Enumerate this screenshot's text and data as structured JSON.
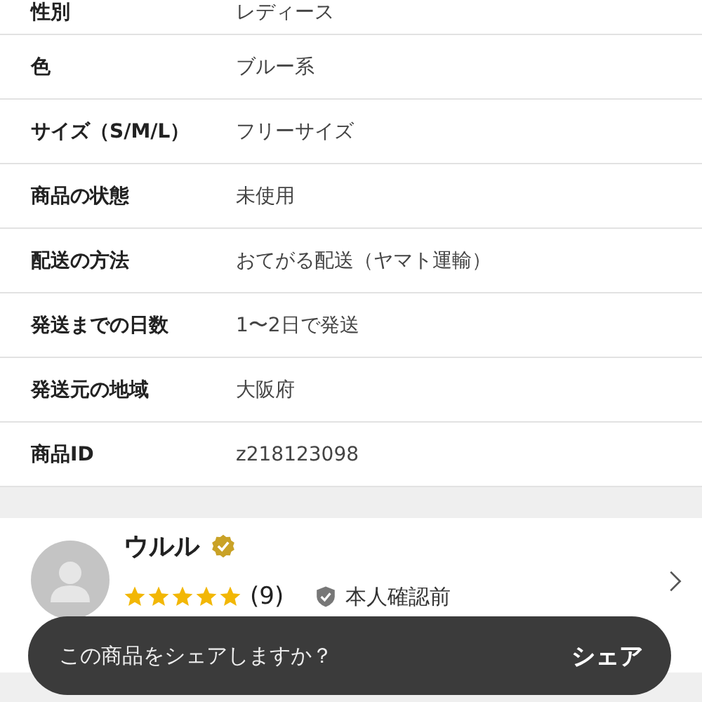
{
  "details": [
    {
      "label": "性別",
      "value": "レディース"
    },
    {
      "label": "色",
      "value": "ブルー系"
    },
    {
      "label": "サイズ（S/M/L）",
      "value": "フリーサイズ"
    },
    {
      "label": "商品の状態",
      "value": "未使用"
    },
    {
      "label": "配送の方法",
      "value": "おてがる配送（ヤマト運輸）"
    },
    {
      "label": "発送までの日数",
      "value": "1〜2日で発送"
    },
    {
      "label": "発送元の地域",
      "value": "大阪府"
    },
    {
      "label": "商品ID",
      "value": "z218123098"
    }
  ],
  "seller": {
    "name": "ウルル",
    "verified": true,
    "stars": 5,
    "review_count": "(9)",
    "identity_status": "本人確認前"
  },
  "toast": {
    "message": "この商品をシェアしますか？",
    "action": "シェア"
  }
}
